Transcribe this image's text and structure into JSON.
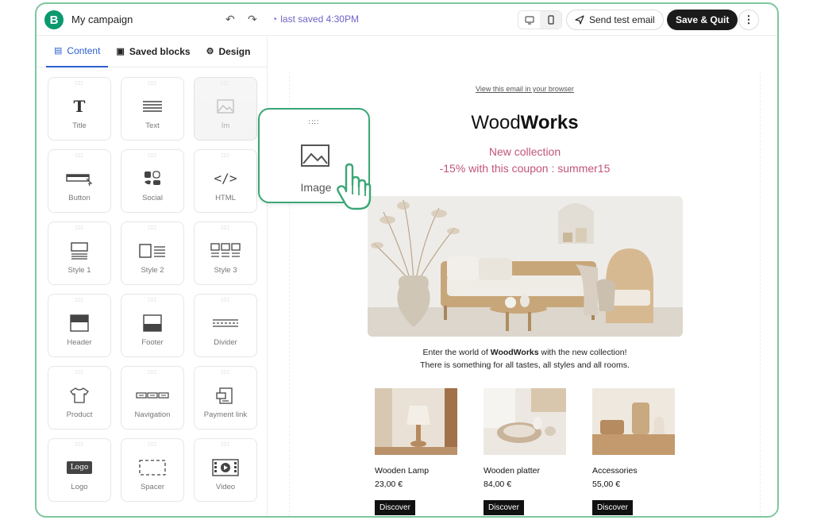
{
  "app": {
    "logo_letter": "B",
    "campaign_name": "My campaign",
    "undo_icon": "undo-icon",
    "redo_icon": "redo-icon",
    "saved_status": "last saved 4:30PM",
    "send_test_label": "Send test email",
    "save_quit_label": "Save & Quit",
    "more_label": "⋮",
    "accent_color": "#0b996e"
  },
  "sidebar": {
    "tabs": [
      {
        "label": "Content",
        "active": true
      },
      {
        "label": "Saved blocks",
        "active": false
      },
      {
        "label": "Design",
        "active": false
      }
    ],
    "blocks": [
      {
        "label": "Title",
        "icon": "title-icon"
      },
      {
        "label": "Text",
        "icon": "text-icon"
      },
      {
        "label": "Im",
        "icon": "image-icon"
      },
      {
        "label": "Button",
        "icon": "button-icon"
      },
      {
        "label": "Social",
        "icon": "social-icon"
      },
      {
        "label": "HTML",
        "icon": "html-icon"
      },
      {
        "label": "Style 1",
        "icon": "style1-icon"
      },
      {
        "label": "Style 2",
        "icon": "style2-icon"
      },
      {
        "label": "Style 3",
        "icon": "style3-icon"
      },
      {
        "label": "Header",
        "icon": "header-icon"
      },
      {
        "label": "Footer",
        "icon": "footer-icon"
      },
      {
        "label": "Divider",
        "icon": "divider-icon"
      },
      {
        "label": "Product",
        "icon": "product-icon"
      },
      {
        "label": "Navigation",
        "icon": "navigation-icon"
      },
      {
        "label": "Payment link",
        "icon": "payment-link-icon"
      },
      {
        "label": "Logo",
        "icon": "logo-icon"
      },
      {
        "label": "Spacer",
        "icon": "spacer-icon"
      },
      {
        "label": "Video",
        "icon": "video-icon"
      }
    ]
  },
  "drag_card": {
    "label": "Image"
  },
  "email": {
    "view_link": "View this email in your browser",
    "brand_part1": "Wood",
    "brand_part2": "Works",
    "promo_line1": "New collection",
    "promo_line2": "-15% with this coupon : summer15",
    "intro_part1": "Enter the world of ",
    "intro_bold": "WoodWorks",
    "intro_part2": " with the new collection!",
    "intro_line2": "There is something for all tastes, all styles and all rooms.",
    "products": [
      {
        "name": "Wooden Lamp",
        "price": "23,00 €",
        "cta": "Discover"
      },
      {
        "name": "Wooden platter",
        "price": "84,00 €",
        "cta": "Discover"
      },
      {
        "name": "Accessories",
        "price": "55,00 €",
        "cta": "Discover"
      }
    ],
    "promo_color": "#c15579"
  }
}
